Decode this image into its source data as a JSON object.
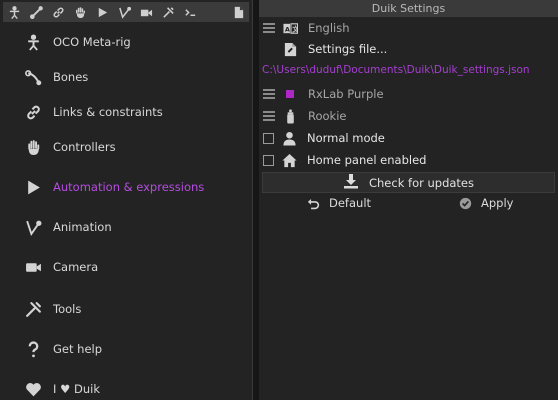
{
  "toolbar": {
    "icons": [
      "rig-icon",
      "bone-icon",
      "link-icon",
      "hand-icon",
      "play-icon",
      "animation-icon",
      "camera-icon",
      "tools-icon",
      "script-icon",
      "file-icon"
    ]
  },
  "menu": {
    "items": [
      {
        "label": "OCO Meta-rig",
        "icon": "oco-icon"
      },
      {
        "label": "Bones",
        "icon": "bone-icon"
      },
      {
        "label": "Links & constraints",
        "icon": "link-icon"
      },
      {
        "label": "Controllers",
        "icon": "hand-icon"
      },
      {
        "label": "Automation & expressions",
        "icon": "play-icon",
        "active": true
      },
      {
        "label": "Animation",
        "icon": "animation-icon"
      },
      {
        "label": "Camera",
        "icon": "camera-icon"
      },
      {
        "label": "Tools",
        "icon": "tools-icon"
      },
      {
        "label": "Get help",
        "icon": "question-icon"
      },
      {
        "label": "I ♥ Duik",
        "icon": "heart-icon"
      }
    ]
  },
  "settings": {
    "title": "Duik Settings",
    "language": "English",
    "settings_file_label": "Settings file...",
    "settings_path": "C:\\Users\\duduf\\Documents\\Duik\\Duik_settings.json",
    "color_scheme": "RxLab Purple",
    "color_swatch": "#b026c9",
    "user_level": "Rookie",
    "normal_mode_label": "Normal mode",
    "home_panel_label": "Home panel enabled",
    "check_updates_label": "Check for updates",
    "default_label": "Default",
    "apply_label": "Apply"
  },
  "colors": {
    "accent": "#b44de0",
    "path": "#a63fd1"
  }
}
